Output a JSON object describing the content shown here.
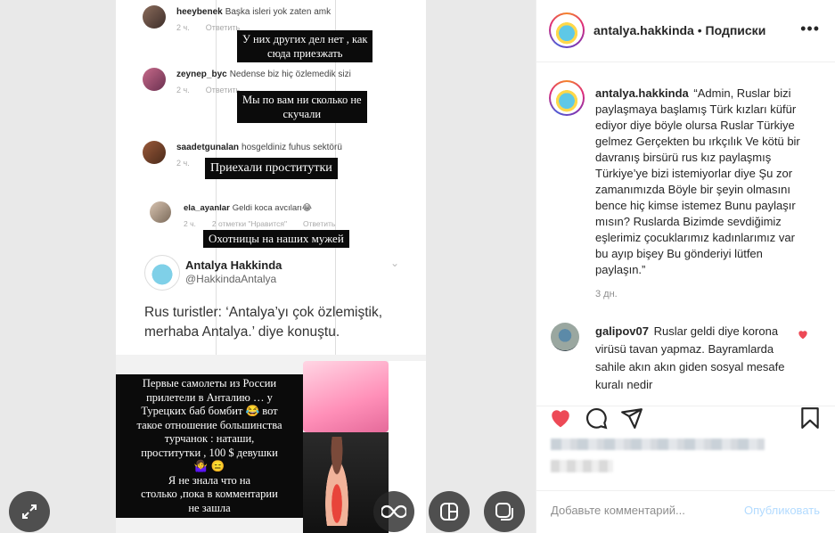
{
  "header": {
    "username": "antalya.hakkinda",
    "separator": " • ",
    "follow_status": "Подписки",
    "more": "•••"
  },
  "caption": {
    "username": "antalya.hakkinda",
    "text": "“Admin, Ruslar bizi paylaşmaya başlamış Türk kızları küfür ediyor diye böyle olursa Ruslar Türkiye gelmez Gerçekten bu ırkçılık Ve kötü bir davranış birsürü rus kız paylaşmış Türkiye’ye bizi istemiyorlar diye Şu zor zamanımızda Böyle bir şeyin olmasını bence hiç kimse istemez Bunu paylaşır mısın? Ruslarda Bizimde sevdiğimiz eşlerimiz çocuklarımız kadınlarımız var bu ayıp bişey Bu gönderiyi lütfen paylaşın.”",
    "time": "3 дн."
  },
  "comment": {
    "username": "galipov07",
    "text": "Ruslar geldi diye korona virüsü tavan yapmaz. Bayramlarda sahile akın akın giden sosyal mesafe kuralı nedir"
  },
  "comment_box": {
    "placeholder": "Добавьте комментарий...",
    "post_label": "Опубликовать"
  },
  "media": {
    "comments": [
      {
        "user": "heeybenek",
        "text": "Başka isleri yok zaten amk",
        "time": "2 ч.",
        "reply": "Ответить"
      },
      {
        "user": "zeynep_byc",
        "text": "Nedense biz hiç özlemedik sizi",
        "time": "2 ч.",
        "reply": "Ответить"
      },
      {
        "user": "saadetgunalan",
        "text": "hosgeldiniz fuhus sektörü",
        "time": "2 ч.",
        "reply": ""
      },
      {
        "user": "ela_ayanlar",
        "text": "Geldi koca avcıları😂",
        "time": "2 ч.",
        "likes": "2 отметки \"Нравится\"",
        "reply": "Ответить"
      }
    ],
    "russian_captions": [
      "У них других дел нет , как\nсюда приезжать",
      "Мы по вам ни сколько не\nскучали",
      "Приехали проститутки",
      "Охотницы на наших мужей",
      "Первые самолеты из России\nприлетели в Анталию … у\nТурецких баб бомбит 😂 вот\nтакое отношение большинства\nтурчанок : наташи,\nпроститутки , 100 $ девушки\n🤷‍♀️ 😑\nЯ не знала что на\nстолько ,пока в комментарии\nне зашла"
    ],
    "tweet": {
      "name": "Antalya Hakkinda",
      "handle": "@HakkindaAntalya",
      "text": "Rus turistler: ‘Antalya’yı çok özlemiştik, merhaba Antalya.’ diye konuştu."
    }
  },
  "colors": {
    "like_red": "#ed4956",
    "post_button": "#b3dbff"
  }
}
